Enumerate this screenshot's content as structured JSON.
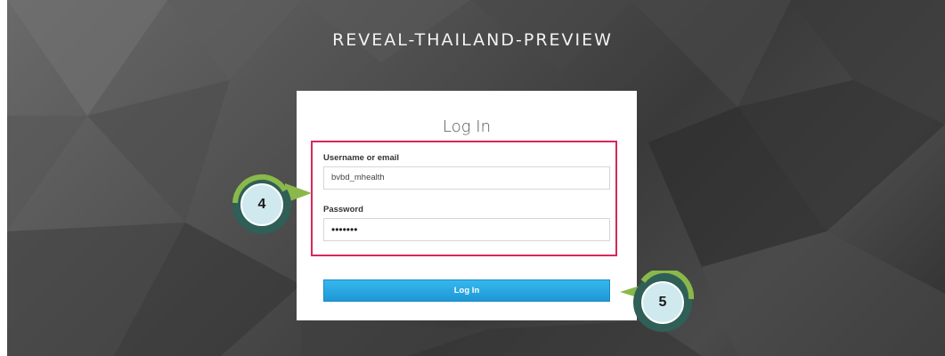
{
  "app": {
    "title": "REVEAL-THAILAND-PREVIEW"
  },
  "login": {
    "heading": "Log In",
    "username_label": "Username or email",
    "username_value": "bvbd_mhealth",
    "password_label": "Password",
    "password_value": "•••••••",
    "submit_label": "Log In"
  },
  "callouts": {
    "step4": "4",
    "step5": "5"
  },
  "colors": {
    "highlight": "#d8275a",
    "button": "#1f98d6",
    "callout_ring": "#2f5f56",
    "callout_arrow": "#8ab84a",
    "callout_fill": "#cfe9ee"
  }
}
